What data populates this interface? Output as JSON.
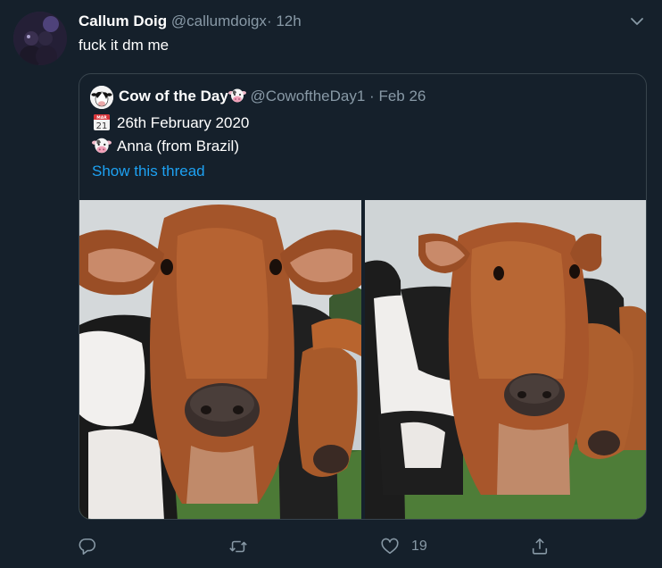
{
  "tweet": {
    "author_name": "Callum Doig",
    "author_handle": "@callumdoigx",
    "separator": "·",
    "time": "12h",
    "text": "fuck it dm me"
  },
  "quote": {
    "author_name": "Cow of the Day",
    "author_handle": "@CowoftheDay1",
    "separator": "·",
    "date": "Feb 26",
    "line1": "26th February 2020",
    "line2": "Anna (from Brazil)",
    "link": "Show this thread",
    "icons": {
      "name_emoji": "cow-face-icon",
      "line1_emoji": "calendar-icon",
      "line2_emoji": "cow-face-icon"
    }
  },
  "actions": {
    "reply_icon": "reply-icon",
    "retweet_icon": "retweet-icon",
    "like_icon": "heart-icon",
    "like_count": "19",
    "share_icon": "share-icon"
  },
  "colors": {
    "background": "#15202b",
    "border": "#38444d",
    "secondary_text": "#8899a6",
    "link": "#1da1f2"
  }
}
